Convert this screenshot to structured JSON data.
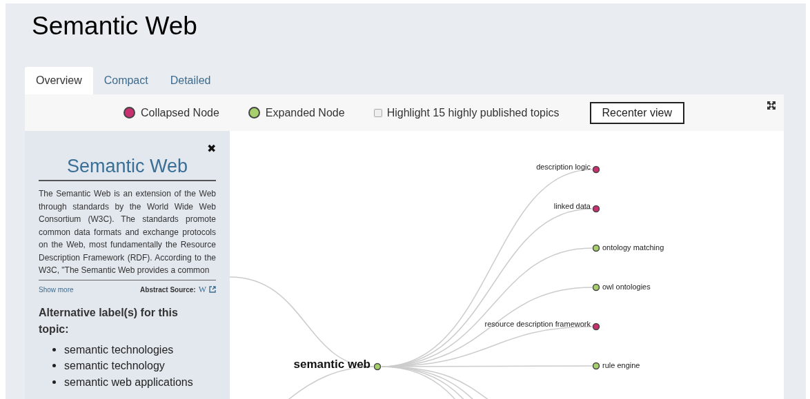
{
  "page_title": "Semantic Web",
  "tabs": [
    {
      "label": "Overview",
      "selected": true
    },
    {
      "label": "Compact",
      "selected": false
    },
    {
      "label": "Detailed",
      "selected": false
    }
  ],
  "legend": [
    {
      "label": "Collapsed Node",
      "color": "#c8306f"
    },
    {
      "label": "Expanded Node",
      "color": "#a7d06c"
    }
  ],
  "highlight": {
    "label": "Highlight 15 highly published topics",
    "checked": false
  },
  "recenter_button": "Recenter view",
  "sidebar": {
    "close": "✖",
    "title": "Semantic Web",
    "abstract": "The Semantic Web is an extension of the Web through standards by the World Wide Web Consortium (W3C). The standards promote common data formats and exchange protocols on the Web, most fundamentally the Resource Description Framework (RDF). According to the W3C, \"The Semantic Web provides a common",
    "show_more": "Show more",
    "source_label": "Abstract Source:",
    "source_mark": "W",
    "alt_heading": "Alternative label(s) for this topic:",
    "alt_labels": [
      "semantic technologies",
      "semantic technology",
      "semantic web applications"
    ]
  },
  "graph": {
    "root": {
      "label": "semantic web",
      "color": "#a7d06c"
    },
    "children": [
      {
        "label": "description logic",
        "color": "#c8306f"
      },
      {
        "label": "linked data",
        "color": "#c8306f"
      },
      {
        "label": "ontology matching",
        "color": "#a7d06c"
      },
      {
        "label": "owl ontologies",
        "color": "#a7d06c"
      },
      {
        "label": "resource description framework",
        "color": "#c8306f"
      },
      {
        "label": "rule engine",
        "color": "#a7d06c"
      }
    ]
  }
}
